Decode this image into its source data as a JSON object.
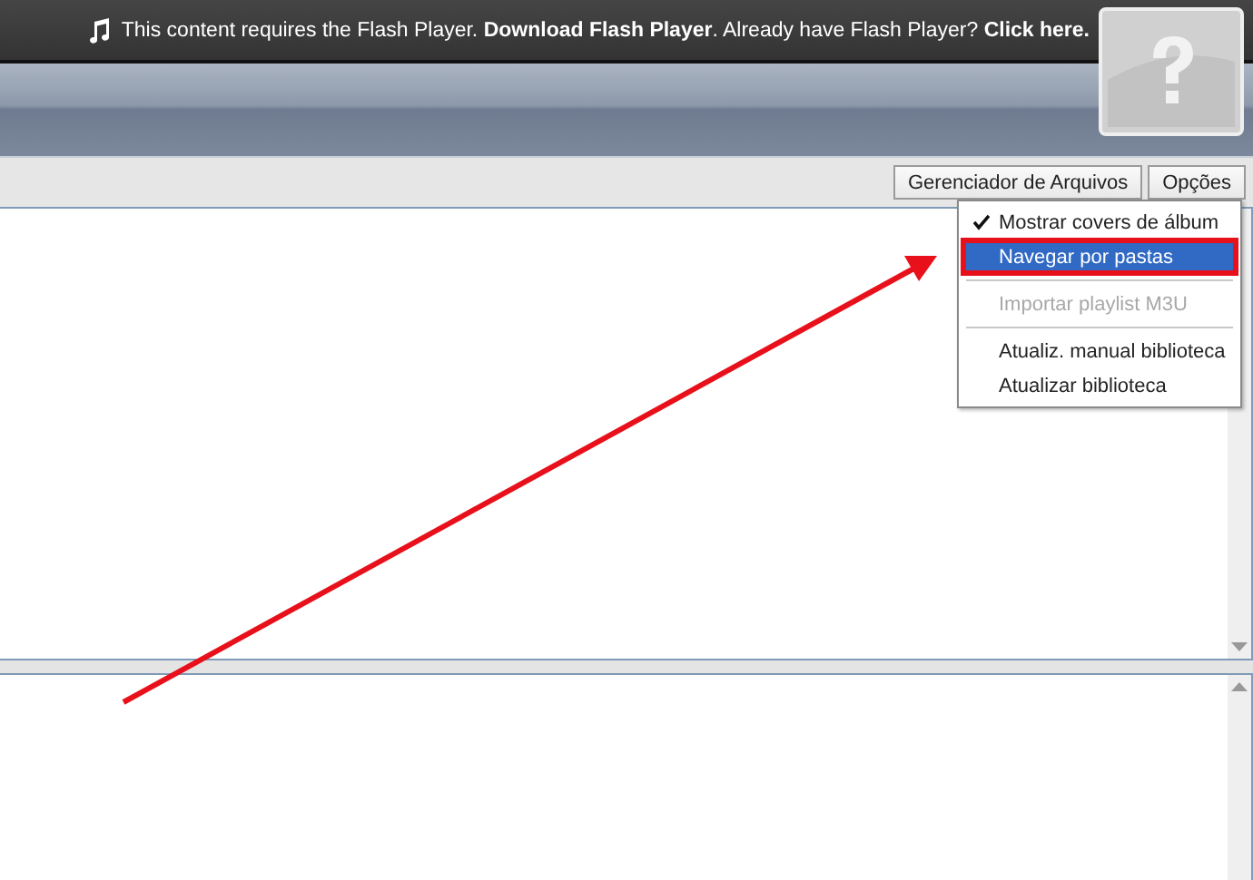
{
  "flash_notice": {
    "message": "This content requires the Flash Player. **Download Flash Player**. Already have Flash Player? **Click here.**"
  },
  "toolbar": {
    "buttons": [
      "Gerenciador de Arquivos",
      "Opções"
    ]
  },
  "options_menu": {
    "items": [
      {
        "kind": "item",
        "label": "Mostrar covers de álbum",
        "checked": true,
        "selected": false,
        "disabled": false,
        "outlined": false
      },
      {
        "kind": "item",
        "label": "Navegar por pastas",
        "checked": false,
        "selected": true,
        "disabled": false,
        "outlined": true
      },
      {
        "kind": "separator"
      },
      {
        "kind": "item",
        "label": "Importar playlist M3U",
        "checked": false,
        "selected": false,
        "disabled": true,
        "outlined": false
      },
      {
        "kind": "separator"
      },
      {
        "kind": "item",
        "label": "Atualiz. manual biblioteca",
        "checked": false,
        "selected": false,
        "disabled": false,
        "outlined": false
      },
      {
        "kind": "item",
        "label": "Atualizar biblioteca",
        "checked": false,
        "selected": false,
        "disabled": false,
        "outlined": false
      }
    ]
  }
}
